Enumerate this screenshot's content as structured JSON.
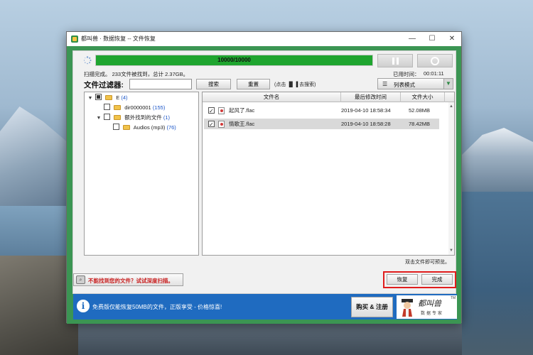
{
  "window": {
    "title": "都叫兽 · 数据恢复 -- 文件恢复",
    "minimize_glyph": "—",
    "maximize_glyph": "☐",
    "close_glyph": "✕"
  },
  "scan": {
    "progress_text": "10000/10000",
    "progress_fraction": 1.0,
    "status": "扫描完成。 233文件被找到，总计 2.37GB。",
    "elapsed_label": "已用时间：",
    "elapsed_value": "00:01:11",
    "pause_icon": "pause-icon",
    "stop_icon": "stop-icon"
  },
  "filter": {
    "label": "文件过滤器:",
    "input_value": "",
    "search_label": "搜索",
    "reset_label": "重置",
    "hint": "(点击 ▐▌▐ 去搜索)",
    "view_icon": "☰",
    "view_mode": "列表模式",
    "view_arrow": "▼"
  },
  "tree": [
    {
      "expander": "▼",
      "check": "partial",
      "name": "E",
      "count": "(4)"
    },
    {
      "expander": "",
      "check": "none",
      "name": "dir0000001",
      "count": "(155)"
    },
    {
      "expander": "▼",
      "check": "none",
      "name": "额外找到的文件",
      "count": "(1)"
    },
    {
      "expander": "",
      "check": "none",
      "name": "Audios (mp3)",
      "count": "(76)"
    }
  ],
  "files": {
    "columns": [
      "文件名",
      "最后修改时间",
      "文件大小"
    ],
    "rows": [
      {
        "checked": true,
        "name": "起风了.flac",
        "modified": "2019-04-10 18:58:34",
        "size": "52.08MB",
        "selected": false
      },
      {
        "checked": true,
        "name": "情歌王.flac",
        "modified": "2019-04-10 18:58:28",
        "size": "78.42MB",
        "selected": true
      }
    ],
    "preview_hint": "双击文件即可预览。"
  },
  "bottom": {
    "deep_scan_label": "不能找到您的文件？试试深度扫描。",
    "recover_label": "恢复",
    "finish_label": "完成"
  },
  "promo": {
    "info_glyph": "i",
    "text": "免费版仅能恢复50MB的文件，正版享受 - 价格惊喜!",
    "buy_label": "购买 & 注册",
    "brand_name": "都叫兽",
    "brand_sub": "数据专家",
    "brand_tm": "TM"
  },
  "colors": {
    "accent_green": "#3b9553",
    "progress_green": "#1fa52f",
    "promo_blue": "#1f6bc0",
    "highlight_red": "#e01d1d"
  }
}
